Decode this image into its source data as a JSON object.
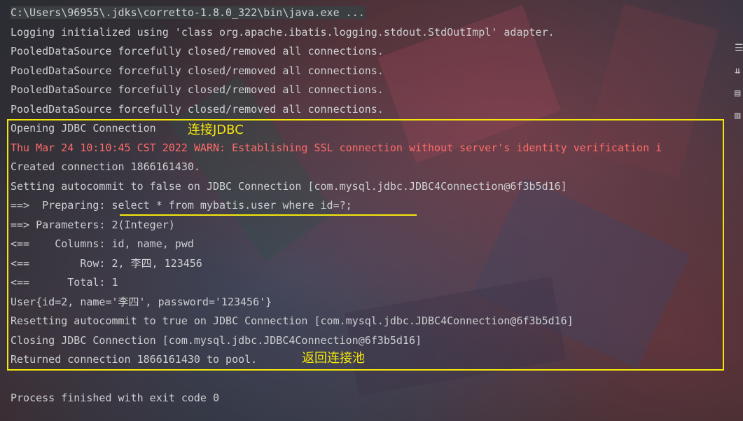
{
  "console": {
    "lines": [
      "C:\\Users\\96955\\.jdks\\corretto-1.8.0_322\\bin\\java.exe ...",
      "Logging initialized using 'class org.apache.ibatis.logging.stdout.StdOutImpl' adapter.",
      "PooledDataSource forcefully closed/removed all connections.",
      "PooledDataSource forcefully closed/removed all connections.",
      "PooledDataSource forcefully closed/removed all connections.",
      "PooledDataSource forcefully closed/removed all connections.",
      "Opening JDBC Connection",
      "Thu Mar 24 10:10:45 CST 2022 WARN: Establishing SSL connection without server's identity verification i",
      "Created connection 1866161430.",
      "Setting autocommit to false on JDBC Connection [com.mysql.jdbc.JDBC4Connection@6f3b5d16]",
      "==>  Preparing: select * from mybatis.user where id=?;",
      "==> Parameters: 2(Integer)",
      "<==    Columns: id, name, pwd",
      "<==        Row: 2, 李四, 123456",
      "<==      Total: 1",
      "User{id=2, name='李四', password='123456'}",
      "Resetting autocommit to true on JDBC Connection [com.mysql.jdbc.JDBC4Connection@6f3b5d16]",
      "Closing JDBC Connection [com.mysql.jdbc.JDBC4Connection@6f3b5d16]",
      "Returned connection 1866161430 to pool.",
      "",
      "Process finished with exit code 0"
    ]
  },
  "annotations": {
    "connect": "连接JDBC",
    "return_pool": "返回连接池"
  },
  "sidebar": {
    "icons": [
      "soft-wrap-icon",
      "scroll-to-end-icon",
      "print-icon",
      "clear-all-icon"
    ]
  },
  "colors": {
    "text": "#cdcfd2",
    "error": "#ff6b68",
    "highlight": "#f6e70b"
  }
}
